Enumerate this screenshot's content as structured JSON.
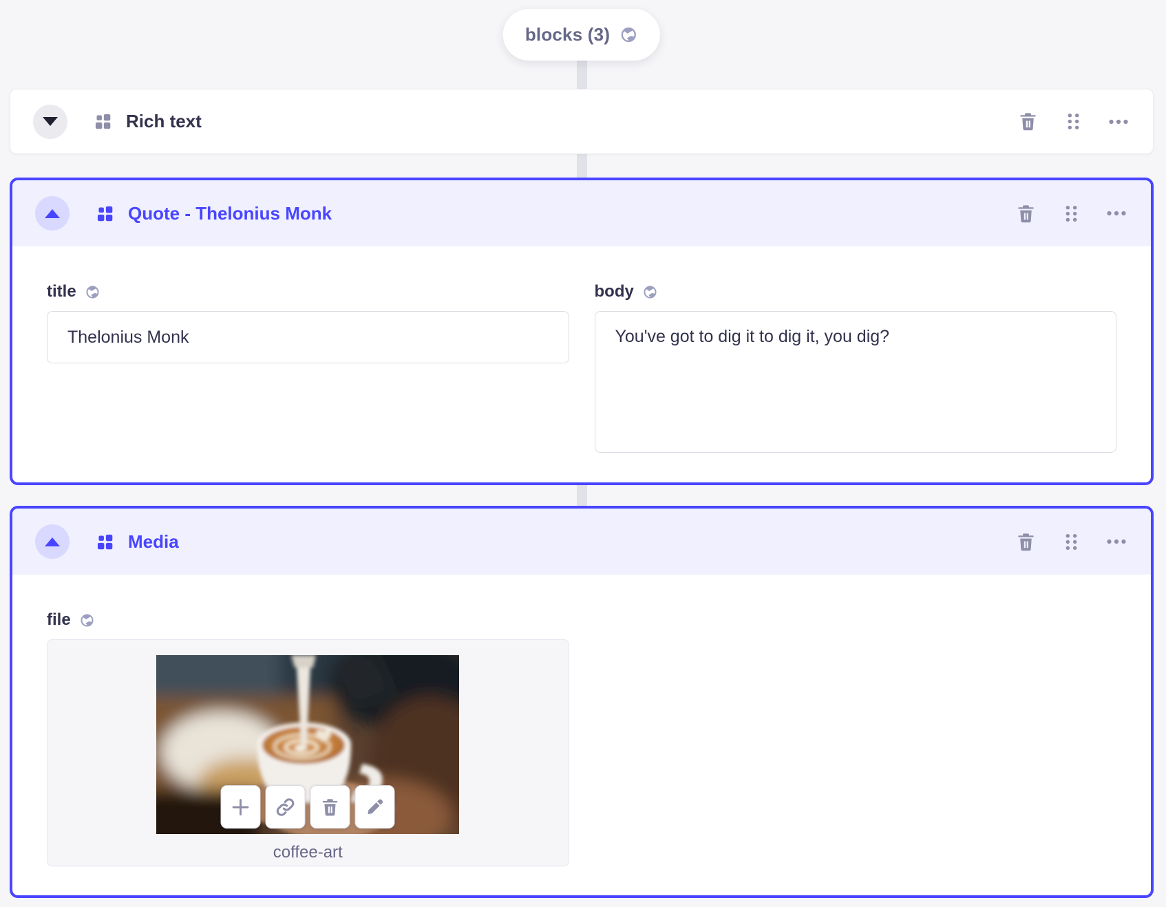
{
  "accent_color": "#4945ff",
  "header_bg_color": "#f0f0ff",
  "page_bg_color": "#f6f6f9",
  "field_group": {
    "label": "blocks (3)",
    "localized_icon": "globe-icon"
  },
  "blocks": [
    {
      "title": "Rich text",
      "state": "collapsed",
      "toggle_icon": "chevron-down-icon",
      "type_icon": "component-grid-icon",
      "actions": {
        "delete": "trash-icon",
        "reorder": "drag-handle-icon",
        "more": "more-options-icon"
      }
    },
    {
      "title": "Quote - Thelonius Monk",
      "state": "expanded",
      "toggle_icon": "chevron-up-icon",
      "type_icon": "component-grid-icon",
      "actions": {
        "delete": "trash-icon",
        "reorder": "drag-handle-icon",
        "more": "more-options-icon"
      },
      "fields": {
        "title": {
          "label": "title",
          "localized_icon": "globe-icon",
          "value": "Thelonius Monk"
        },
        "body": {
          "label": "body",
          "localized_icon": "globe-icon",
          "value": "You've got to dig it to dig it, you dig?"
        }
      }
    },
    {
      "title": "Media",
      "state": "expanded",
      "toggle_icon": "chevron-up-icon",
      "type_icon": "component-grid-icon",
      "actions": {
        "delete": "trash-icon",
        "reorder": "drag-handle-icon",
        "more": "more-options-icon"
      },
      "fields": {
        "file": {
          "label": "file",
          "localized_icon": "globe-icon",
          "filename": "coffee-art",
          "media_actions": [
            "plus-icon",
            "link-icon",
            "trash-icon",
            "pencil-icon"
          ]
        }
      }
    }
  ]
}
